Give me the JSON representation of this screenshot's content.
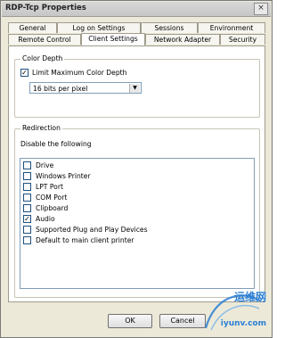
{
  "window": {
    "title": "RDP-Tcp Properties",
    "close_glyph": "×"
  },
  "tabs": {
    "row1": [
      "General",
      "Log on Settings",
      "Sessions",
      "Environment"
    ],
    "row2": [
      "Remote Control",
      "Client Settings",
      "Network Adapter",
      "Security"
    ],
    "active": "Client Settings"
  },
  "color_depth": {
    "group_title": "Color Depth",
    "limit_label": "Limit Maximum Color Depth",
    "limit_checked": true,
    "check_glyph": "✓",
    "selected_depth": "16 bits per pixel",
    "dropdown_arrow": "▼"
  },
  "redirection": {
    "group_title": "Redirection",
    "disable_label": "Disable the following",
    "items": [
      {
        "label": "Drive",
        "checked": false
      },
      {
        "label": "Windows Printer",
        "checked": false
      },
      {
        "label": "LPT Port",
        "checked": false
      },
      {
        "label": "COM Port",
        "checked": false
      },
      {
        "label": "Clipboard",
        "checked": false
      },
      {
        "label": "Audio",
        "checked": true
      },
      {
        "label": "Supported Plug and Play Devices",
        "checked": false
      },
      {
        "label": "Default to main client printer",
        "checked": false
      }
    ]
  },
  "buttons": {
    "ok": "OK",
    "cancel": "Cancel"
  },
  "watermark": {
    "text_cn": "运维网",
    "domain": "iyunv.com",
    "accent": "#2a7fd4"
  }
}
